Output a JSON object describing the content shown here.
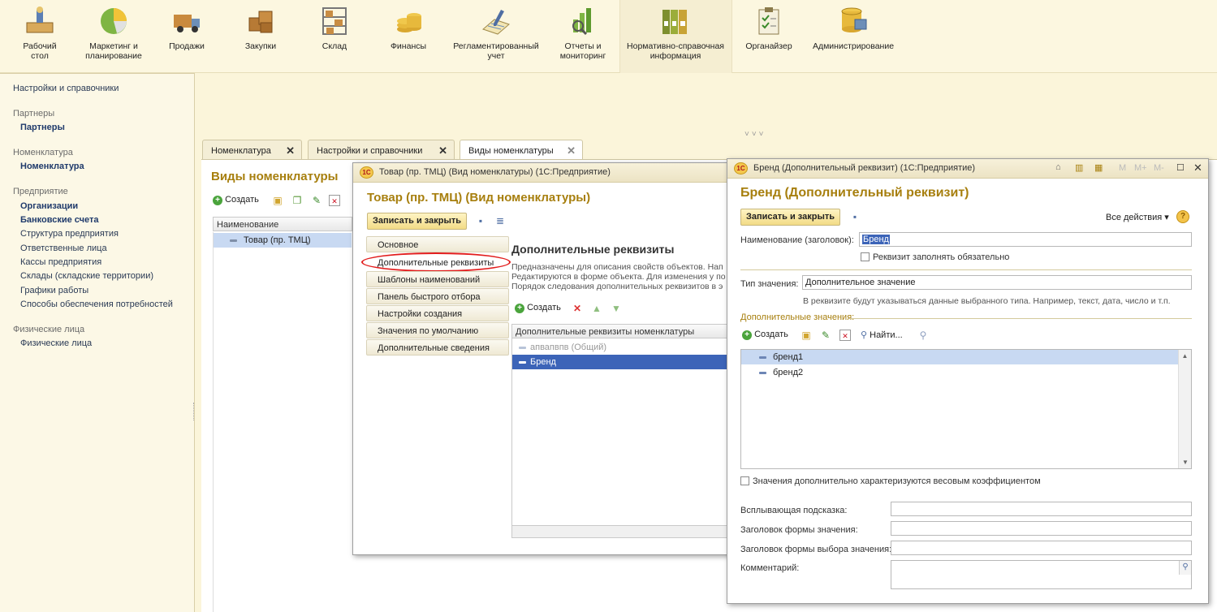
{
  "sections": [
    {
      "label": "Рабочий\nстол",
      "icon": "desktop-icon"
    },
    {
      "label": "Маркетинг и\nпланирование",
      "icon": "pie-chart-icon"
    },
    {
      "label": "Продажи",
      "icon": "truck-icon"
    },
    {
      "label": "Закупки",
      "icon": "boxes-icon"
    },
    {
      "label": "Склад",
      "icon": "warehouse-shelf-icon"
    },
    {
      "label": "Финансы",
      "icon": "coins-icon"
    },
    {
      "label": "Регламентированный\nучет",
      "icon": "ledger-icon"
    },
    {
      "label": "Отчеты и\nмониторинг",
      "icon": "bar-report-icon"
    },
    {
      "label": "Нормативно-справочная\nинформация",
      "icon": "binders-icon"
    },
    {
      "label": "Органайзер",
      "icon": "clipboard-icon"
    },
    {
      "label": "Администрирование",
      "icon": "database-icon"
    }
  ],
  "left_panel": {
    "top_link": "Настройки и справочники",
    "groups": [
      {
        "title": "Партнеры",
        "items": [
          {
            "label": "Партнеры",
            "bold": true
          }
        ]
      },
      {
        "title": "Номенклатура",
        "items": [
          {
            "label": "Номенклатура",
            "bold": true
          }
        ]
      },
      {
        "title": "Предприятие",
        "items": [
          {
            "label": "Организации",
            "bold": true
          },
          {
            "label": "Банковские счета",
            "bold": true
          },
          {
            "label": "Структура предприятия"
          },
          {
            "label": "Ответственные лица"
          },
          {
            "label": "Кассы предприятия"
          },
          {
            "label": "Склады (складские территории)"
          },
          {
            "label": "Графики работы"
          },
          {
            "label": "Способы обеспечения потребностей"
          }
        ]
      },
      {
        "title": "Физические лица",
        "items": [
          {
            "label": "Физические лица"
          }
        ]
      }
    ]
  },
  "tabs": [
    {
      "label": "Номенклатура"
    },
    {
      "label": "Настройки и справочники"
    },
    {
      "label": "Виды номенклатуры"
    }
  ],
  "list_form": {
    "title": "Виды номенклатуры",
    "create": "Создать",
    "col": "Наименование",
    "row": "Товар (пр. ТМЦ)"
  },
  "item_window": {
    "window_title": "Товар (пр. ТМЦ) (Вид номенклатуры)  (1С:Предприятие)",
    "title": "Товар (пр. ТМЦ) (Вид номенклатуры)",
    "save_close": "Записать и закрыть",
    "nav": [
      "Основное",
      "Дополнительные реквизиты",
      "Шаблоны наименований",
      "Панель быстрого отбора",
      "Настройки создания",
      "Значения по умолчанию",
      "Дополнительные сведения"
    ],
    "section_title": "Дополнительные реквизиты",
    "desc1": "Предназначены для описания свойств объектов. Нап",
    "desc2": "Редактируются в форме объекта. Для изменения у по",
    "desc3": "Порядок следования дополнительных реквизитов в э",
    "create": "Создать",
    "grid_head": "Дополнительные реквизиты номенклатуры",
    "rows": [
      "апвапвпв (Общий)",
      "Бренд"
    ]
  },
  "brand_window": {
    "window_title": "Бренд (Дополнительный реквизит)  (1С:Предприятие)",
    "title": "Бренд (Дополнительный реквизит)",
    "save_close": "Записать и закрыть",
    "all_actions": "Все действия",
    "name_label": "Наименование (заголовок):",
    "name_value": "Бренд",
    "required_label": "Реквизит заполнять обязательно",
    "type_label": "Тип значения:",
    "type_value": "Дополнительное значение",
    "type_hint": "В реквизите будут указываться данные выбранного типа. Например, текст, дата, число и т.п.",
    "values_label": "Дополнительные значения:",
    "create": "Создать",
    "find": "Найти...",
    "values": [
      "бренд1",
      "бренд2"
    ],
    "weight_label": "Значения дополнительно характеризуются весовым коэффициентом",
    "tooltip_label": "Всплывающая подсказка:",
    "form_title_label": "Заголовок формы значения:",
    "choice_title_label": "Заголовок формы выбора значения:",
    "comment_label": "Комментарий:",
    "title_buttons": {
      "m": "M",
      "mplus": "M+",
      "mminus": "M-"
    }
  },
  "colors": {
    "accent": "#a77f0e",
    "selection": "#3c64b8",
    "highlight": "#e21c1c"
  }
}
